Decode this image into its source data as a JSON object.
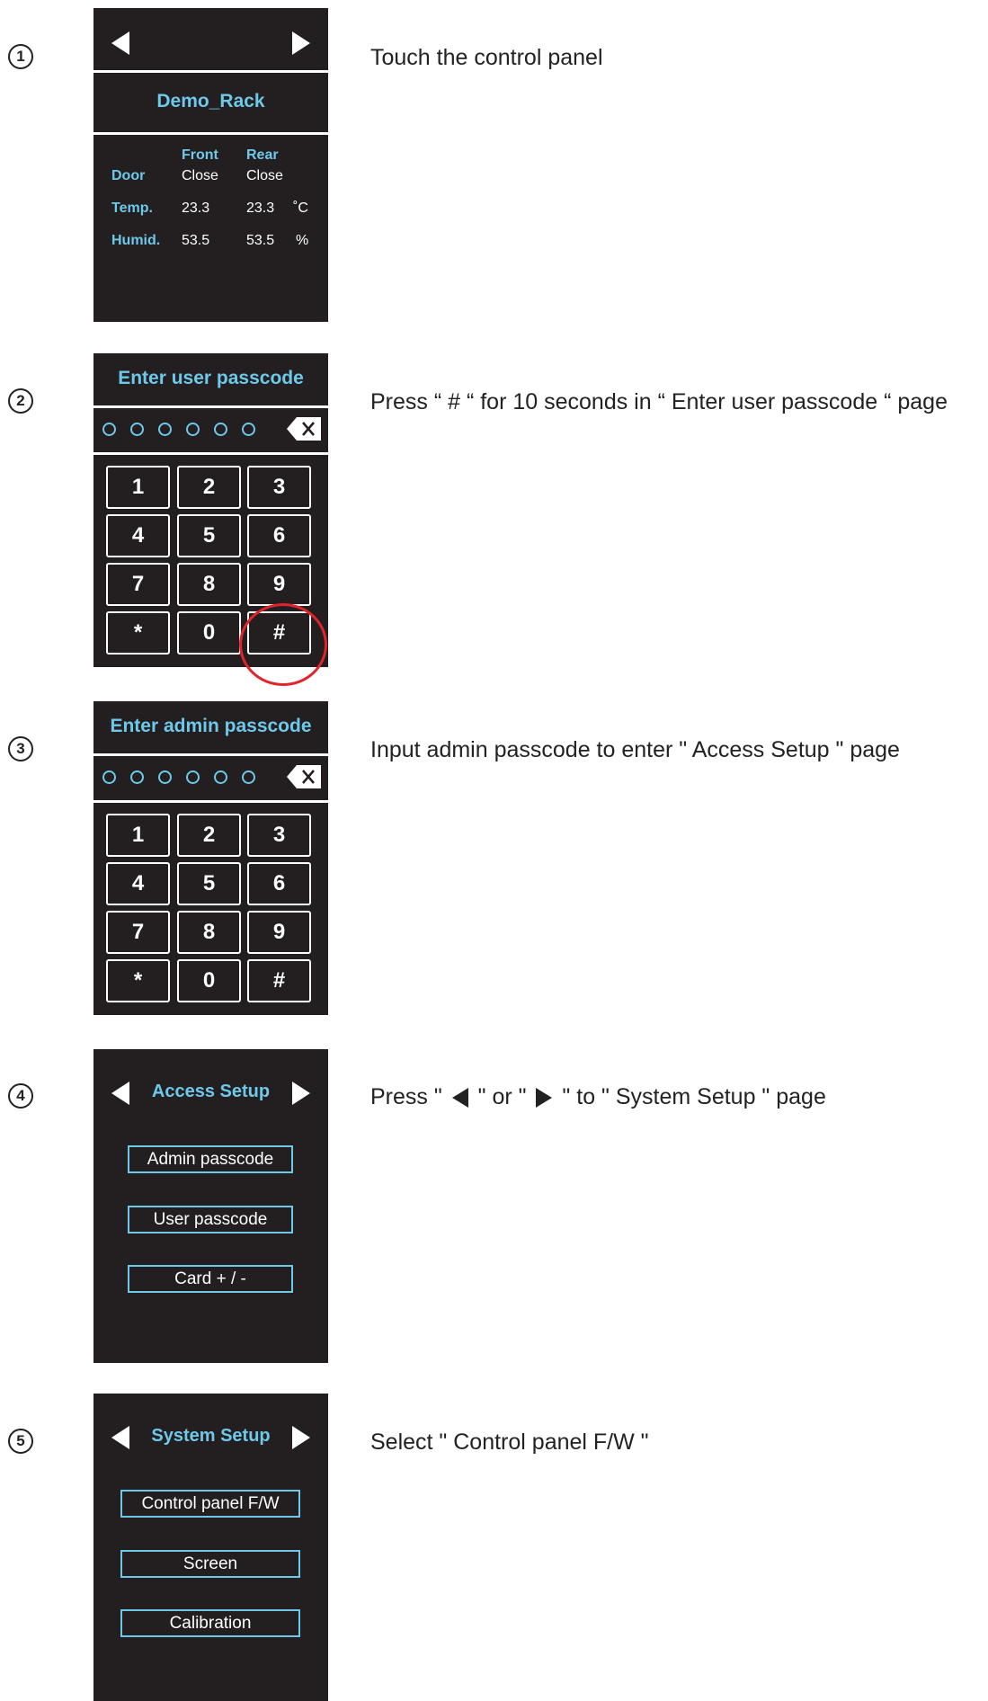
{
  "steps": [
    {
      "number": "1",
      "instruction": "Touch the control panel"
    },
    {
      "number": "2",
      "instruction": "Press “ # “ for 10 seconds in “ Enter user passcode “ page"
    },
    {
      "number": "3",
      "instruction": "Input admin passcode to enter \" Access Setup \" page"
    },
    {
      "number": "4",
      "instruction_prefix": "Press \"",
      "instruction_mid1": "\"  or  \"",
      "instruction_mid2": "\"  to \" System Setup \" page"
    },
    {
      "number": "5",
      "instruction": "Select \" Control panel F/W \""
    }
  ],
  "status_panel": {
    "rack_name": "Demo_Rack",
    "col_front": "Front",
    "col_rear": "Rear",
    "rows": [
      {
        "label": "Door",
        "front": "Close",
        "rear": "Close",
        "unit": ""
      },
      {
        "label": "Temp.",
        "front": "23.3",
        "rear": "23.3",
        "unit": "˚C"
      },
      {
        "label": "Humid.",
        "front": "53.5",
        "rear": "53.5",
        "unit": "%"
      }
    ]
  },
  "user_keypad": {
    "title": "Enter user passcode",
    "keys": [
      "1",
      "2",
      "3",
      "4",
      "5",
      "6",
      "7",
      "8",
      "9",
      "*",
      "0",
      "#"
    ]
  },
  "admin_keypad": {
    "title": "Enter admin passcode",
    "keys": [
      "1",
      "2",
      "3",
      "4",
      "5",
      "6",
      "7",
      "8",
      "9",
      "*",
      "0",
      "#"
    ]
  },
  "access_setup": {
    "title": "Access Setup",
    "buttons": [
      "Admin passcode",
      "User passcode",
      "Card + / -"
    ]
  },
  "system_setup": {
    "title": "System Setup",
    "buttons": [
      "Control panel F/W",
      "Screen",
      "Calibration"
    ]
  },
  "colors": {
    "panel_bg": "#231f20",
    "accent": "#6ec8ea",
    "highlight": "#e0242b"
  }
}
